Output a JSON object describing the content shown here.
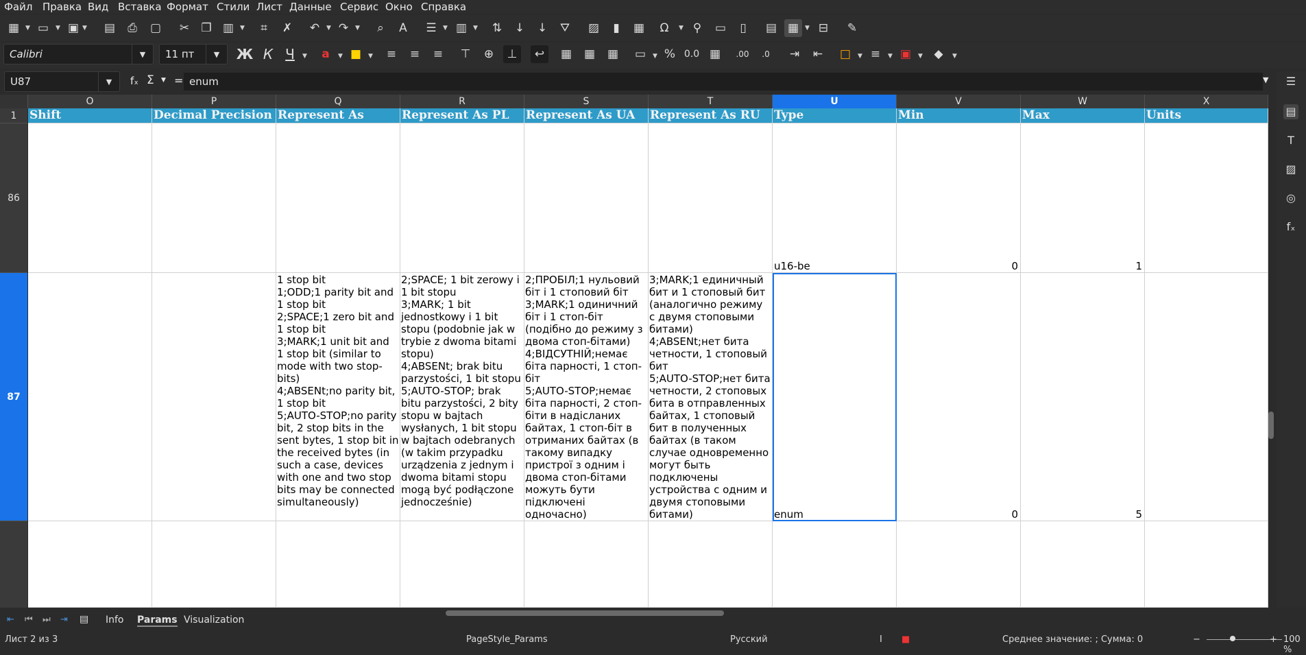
{
  "menu": [
    "Файл",
    "Правка",
    "Вид",
    "Вставка",
    "Формат",
    "Стили",
    "Лист",
    "Данные",
    "Сервис",
    "Окно",
    "Справка"
  ],
  "font": {
    "name": "Calibri",
    "size": "11 пт"
  },
  "icons": {
    "bold": "Ж",
    "italic": "К",
    "underline": "Ч",
    "fx": "fₓ",
    "sum": "Σ",
    "eq": "="
  },
  "formula": {
    "name_box": "U87",
    "content": "enum"
  },
  "columns": [
    {
      "letter": "O",
      "header": "Shift"
    },
    {
      "letter": "P",
      "header": "Decimal Precision"
    },
    {
      "letter": "Q",
      "header": "Represent As"
    },
    {
      "letter": "R",
      "header": "Represent As PL"
    },
    {
      "letter": "S",
      "header": "Represent As UA"
    },
    {
      "letter": "T",
      "header": "Represent As RU"
    },
    {
      "letter": "U",
      "header": "Type"
    },
    {
      "letter": "V",
      "header": "Min"
    },
    {
      "letter": "W",
      "header": "Max"
    },
    {
      "letter": "X",
      "header": "Units"
    }
  ],
  "rows": {
    "r1": "1",
    "r86": "86",
    "r87": "87"
  },
  "row86": {
    "type": "u16-be",
    "min": "0",
    "max": "1"
  },
  "row87": {
    "q": "1 stop bit\n1;ODD;1 parity bit and 1 stop bit\n2;SPACE;1 zero bit and 1 stop bit\n3;MARK;1 unit bit and 1 stop bit (similar to mode with two stop-bits)\n4;ABSENt;no parity bit, 1 stop bit\n5;AUTO-STOP;no parity bit, 2 stop bits in the sent bytes, 1 stop bit in the received bytes (in such a case, devices with one and two stop bits may be connected simultaneously)",
    "r": "2;SPACE; 1 bit zerowy i 1 bit stopu\n3;MARK; 1 bit jednostkowy i 1 bit stopu (podobnie jak w trybie z dwoma bitami stopu)\n4;ABSENt; brak bitu parzystości, 1 bit stopu\n5;AUTO-STOP; brak bitu parzystości, 2 bity stopu w bajtach wysłanych, 1 bit stopu w bajtach odebranych (w takim przypadku urządzenia z jednym i dwoma bitami stopu mogą być podłączone jednocześnie)",
    "s": "2;ПРОБІЛ;1 нульовий біт і 1 стоповий біт\n3;MARK;1 одиничний біт і 1 стоп-біт (подібно до режиму з двома стоп-бітами)\n4;ВІДСУТНІЙ;немає біта парності, 1 стоп-біт\n5;AUTO-STOP;немає біта парності, 2 стоп-біти в надісланих байтах, 1 стоп-біт в отриманих байтах (в такому випадку пристрої з одним і двома стоп-бітами можуть бути підключені одночасно)",
    "t": "3;MARK;1 единичный бит и 1 стоповый бит (аналогично режиму с двумя стоповыми битами)\n4;ABSENt;нет бита четности, 1 стоповый бит\n5;AUTO-STOP;нет бита четности, 2 стоповых бита в отправленных байтах, 1 стоповый бит в полученных байтах (в таком случае одновременно могут быть подключены устройства с одним и двумя стоповыми битами)",
    "type": "enum",
    "min": "0",
    "max": "5"
  },
  "tabs": [
    "Info",
    "Params",
    "Visualization"
  ],
  "active_tab": "Params",
  "status": {
    "sheet": "Лист 2 из 3",
    "page_style": "PageStyle_Params",
    "language": "Русский",
    "sum": "Среднее значение: ; Сумма: 0",
    "zoom": "100 %"
  },
  "colors": {
    "header_fill": "#2e9bc9",
    "selection": "#1a73e8"
  }
}
